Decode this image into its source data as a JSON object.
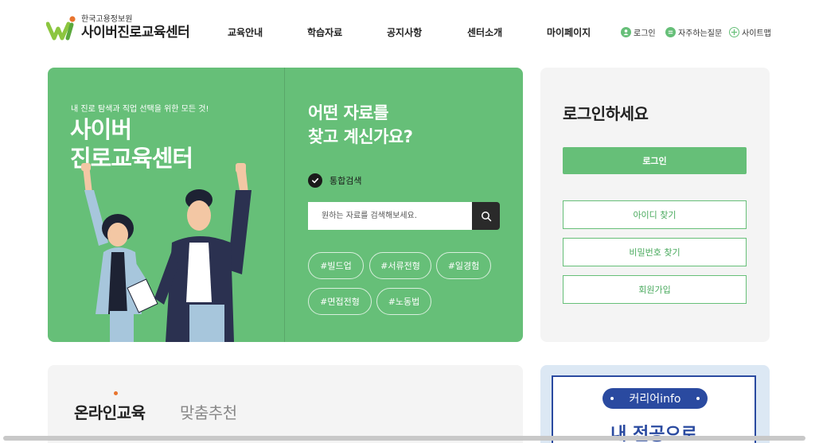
{
  "header": {
    "logo_org": "한국고용정보원",
    "logo_name": "사이버진로교육센터",
    "nav": [
      "교육안내",
      "학습자료",
      "공지사항",
      "센터소개",
      "마이페이지"
    ],
    "util": [
      {
        "label": "로그인",
        "icon": "user-icon"
      },
      {
        "label": "자주하는질문",
        "icon": "chat-icon"
      },
      {
        "label": "사이트맵",
        "icon": "sitemap-icon"
      }
    ]
  },
  "hero": {
    "tagline": "내 진로 탐색과 직업 선택을 위한 모든 것!",
    "title": "사이버\n진로교육센터",
    "search_question": "어떤 자료를\n찾고 계신가요?",
    "integrated_search_label": "통합검색",
    "search_placeholder": "원하는 자료를 검색해보세요.",
    "tags": [
      "#빌드업",
      "#서류전형",
      "#일경험",
      "#면접전형",
      "#노동법"
    ]
  },
  "login": {
    "title": "로그인하세요",
    "login_button": "로그인",
    "find_id": "아이디 찾기",
    "find_password": "비밀번호 찾기",
    "signup": "회원가입"
  },
  "edu": {
    "tabs": [
      "온라인교육",
      "맞춤추천"
    ],
    "active_tab": 0
  },
  "career": {
    "pill": "커리어info",
    "headline": "내 전공으로"
  },
  "colors": {
    "brand_green": "#66bf78",
    "accent_orange": "#e8742e",
    "career_blue": "#2a4aa0"
  }
}
